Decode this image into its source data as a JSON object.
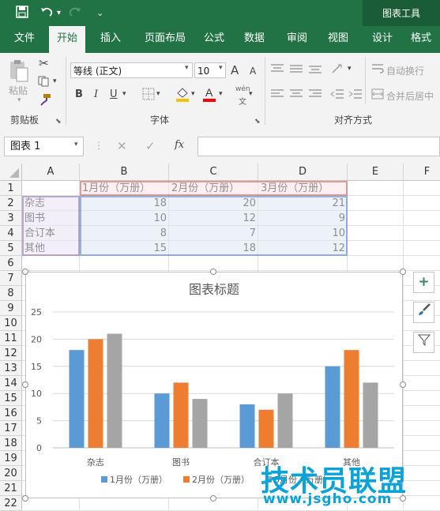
{
  "titlebar": {
    "context_title": "图表工具",
    "icons": [
      "save-icon",
      "undo-icon",
      "redo-icon",
      "customize-qat-icon"
    ]
  },
  "tabs": [
    {
      "label": "文件",
      "active": false
    },
    {
      "label": "开始",
      "active": true
    },
    {
      "label": "插入",
      "active": false
    },
    {
      "label": "页面布局",
      "active": false
    },
    {
      "label": "公式",
      "active": false
    },
    {
      "label": "数据",
      "active": false
    },
    {
      "label": "审阅",
      "active": false
    },
    {
      "label": "视图",
      "active": false
    },
    {
      "label": "设计",
      "active": false
    },
    {
      "label": "格式",
      "active": false
    }
  ],
  "ribbon": {
    "clipboard": {
      "paste_label": "粘贴",
      "group_label": "剪贴板"
    },
    "font": {
      "font_name": "等线 (正文)",
      "font_size": "10",
      "bold": "B",
      "italic": "I",
      "underline": "U",
      "grow": "A",
      "shrink": "A",
      "wen": "wén",
      "group_label": "字体"
    },
    "alignment": {
      "wrap_text": "自动换行",
      "merge_center": "合并后居中",
      "group_label": "对齐方式"
    }
  },
  "formula_bar": {
    "name_box": "图表 1",
    "fx": "fx",
    "formula": ""
  },
  "columns": [
    "A",
    "B",
    "C",
    "D",
    "E",
    "F"
  ],
  "rows": [
    "1",
    "2",
    "3",
    "4",
    "5",
    "6",
    "7",
    "8",
    "9",
    "10",
    "11",
    "12",
    "13",
    "14",
    "15",
    "16",
    "17",
    "18",
    "19",
    "20",
    "21",
    "22"
  ],
  "table": {
    "headers": [
      "1月份（万册）",
      "2月份（万册）",
      "3月份（万册）"
    ],
    "rows": [
      {
        "label": "杂志",
        "values": [
          "18",
          "20",
          "21"
        ]
      },
      {
        "label": "图书",
        "values": [
          "10",
          "12",
          "9"
        ]
      },
      {
        "label": "合订本",
        "values": [
          "8",
          "7",
          "10"
        ]
      },
      {
        "label": "其他",
        "values": [
          "15",
          "18",
          "12"
        ]
      }
    ]
  },
  "chart_data": {
    "type": "bar",
    "title": "图表标题",
    "categories": [
      "杂志",
      "图书",
      "合订本",
      "其他"
    ],
    "series": [
      {
        "name": "1月份（万册）",
        "values": [
          18,
          10,
          8,
          15
        ],
        "color": "#5b9bd5"
      },
      {
        "name": "2月份（万册）",
        "values": [
          20,
          12,
          7,
          18
        ],
        "color": "#ed7d31"
      },
      {
        "name": "3月份（万册）",
        "values": [
          21,
          9,
          10,
          12
        ],
        "color": "#a5a5a5"
      }
    ],
    "ylim": [
      0,
      25
    ],
    "yticks": [
      "0",
      "5",
      "10",
      "15",
      "20",
      "25"
    ],
    "grid": true,
    "legend": "bottom"
  },
  "watermark": {
    "text": "技术员联盟",
    "url": "www.jsgho.com"
  },
  "colors": {
    "brand": "#217346",
    "accent_red": "#ff0000",
    "accent_orange": "#ed7d31"
  }
}
